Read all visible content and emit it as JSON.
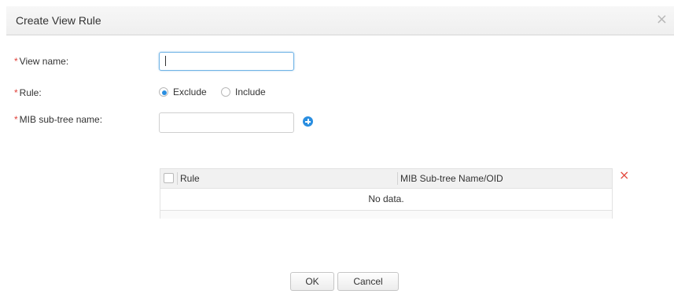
{
  "dialog": {
    "title": "Create View Rule",
    "close_icon": "×"
  },
  "form": {
    "required_mark": "*",
    "view_name": {
      "label": "View name:",
      "value": ""
    },
    "rule": {
      "label": "Rule:",
      "options": [
        {
          "label": "Exclude",
          "selected": true
        },
        {
          "label": "Include",
          "selected": false
        }
      ]
    },
    "mib_subtree": {
      "label": "MIB sub-tree name:",
      "value": ""
    },
    "add_icon": "plus-circle-icon"
  },
  "table": {
    "columns": [
      "Rule",
      "MIB Sub-tree Name/OID"
    ],
    "empty_text": "No data.",
    "delete_icon": "×"
  },
  "buttons": {
    "ok": "OK",
    "cancel": "Cancel"
  },
  "colors": {
    "accent": "#2a8ee0",
    "required": "#e0413a",
    "delete": "#e34a3f"
  }
}
